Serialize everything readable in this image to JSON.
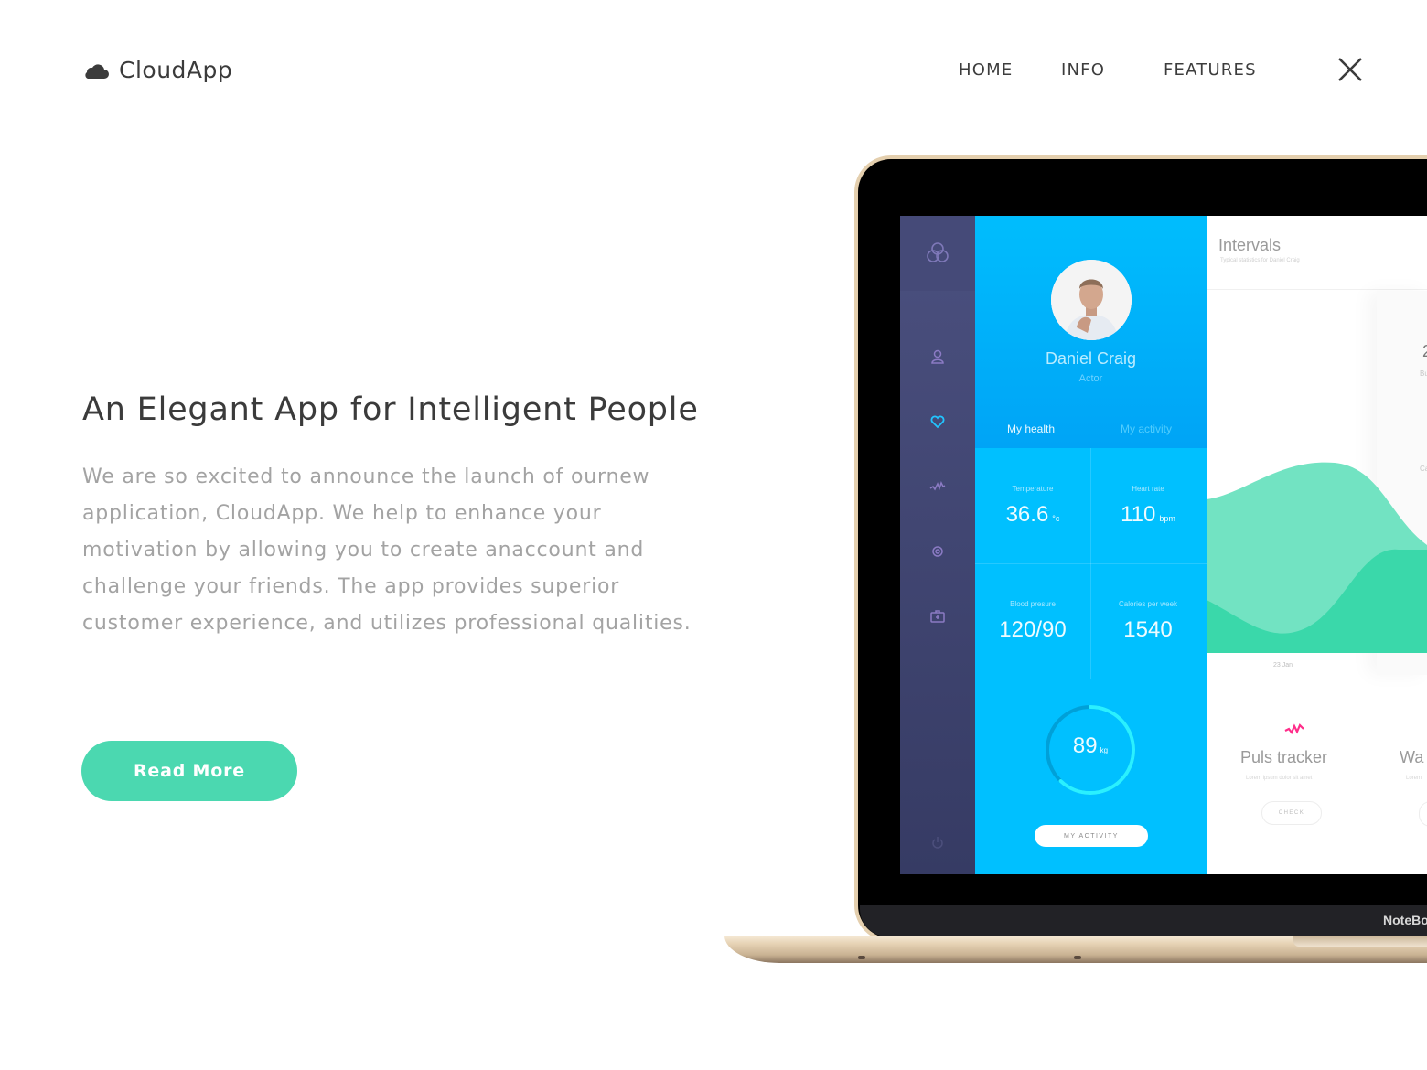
{
  "header": {
    "brand": "CloudApp",
    "nav": [
      "HOME",
      "INFO",
      "FEATURES"
    ],
    "close_icon": "close-icon"
  },
  "hero": {
    "title": "An Elegant App for Intelligent People",
    "body": "We are so excited to announce the launch of ournew application, CloudApp. We help to enhance your motivation by allowing you to create anaccount and challenge your friends. The app provides superior customer experience, and utilizes professional qualities.",
    "cta": "Read More",
    "cta_color": "#4bd8b0"
  },
  "device": {
    "brand_label": "NoteBo"
  },
  "app": {
    "sidebar_icons": [
      "logo-icon",
      "user-icon",
      "heart-icon",
      "pulse-icon",
      "gear-icon",
      "medkit-icon",
      "power-icon"
    ],
    "profile": {
      "name": "Daniel Craig",
      "role": "Actor",
      "tabs": [
        "My health",
        "My activity"
      ],
      "stats": [
        {
          "label": "Temperature",
          "value": "36.6",
          "unit": "°c"
        },
        {
          "label": "Heart rate",
          "value": "110",
          "unit": "bpm"
        },
        {
          "label": "Blood presure",
          "value": "120/90",
          "unit": ""
        },
        {
          "label": "Calories per week",
          "value": "1540",
          "unit": ""
        }
      ],
      "weight": {
        "value": "89",
        "unit": "kg",
        "progress": 0.62
      },
      "activity_button": "MY ACTIVITY"
    },
    "intervals": {
      "title": "Intervals",
      "subtitle": "Typical statistics for Daniel Craig",
      "x_label": "23 Jan",
      "edge_value": "2",
      "edge_label": "Bu",
      "edge_label2": "Ca"
    },
    "features": [
      {
        "title": "Puls tracker",
        "desc": "Lorem ipsum dolor sit amet",
        "button": "CHECK"
      },
      {
        "title": "Wa",
        "desc": "Lorem",
        "button": ""
      }
    ],
    "colors": {
      "sidebar": "#454a78",
      "profile": "#00c0ff",
      "chart_light": "#72e3c2",
      "chart_dark": "#3ad8aa",
      "pulse": "#ff2d8a"
    }
  }
}
